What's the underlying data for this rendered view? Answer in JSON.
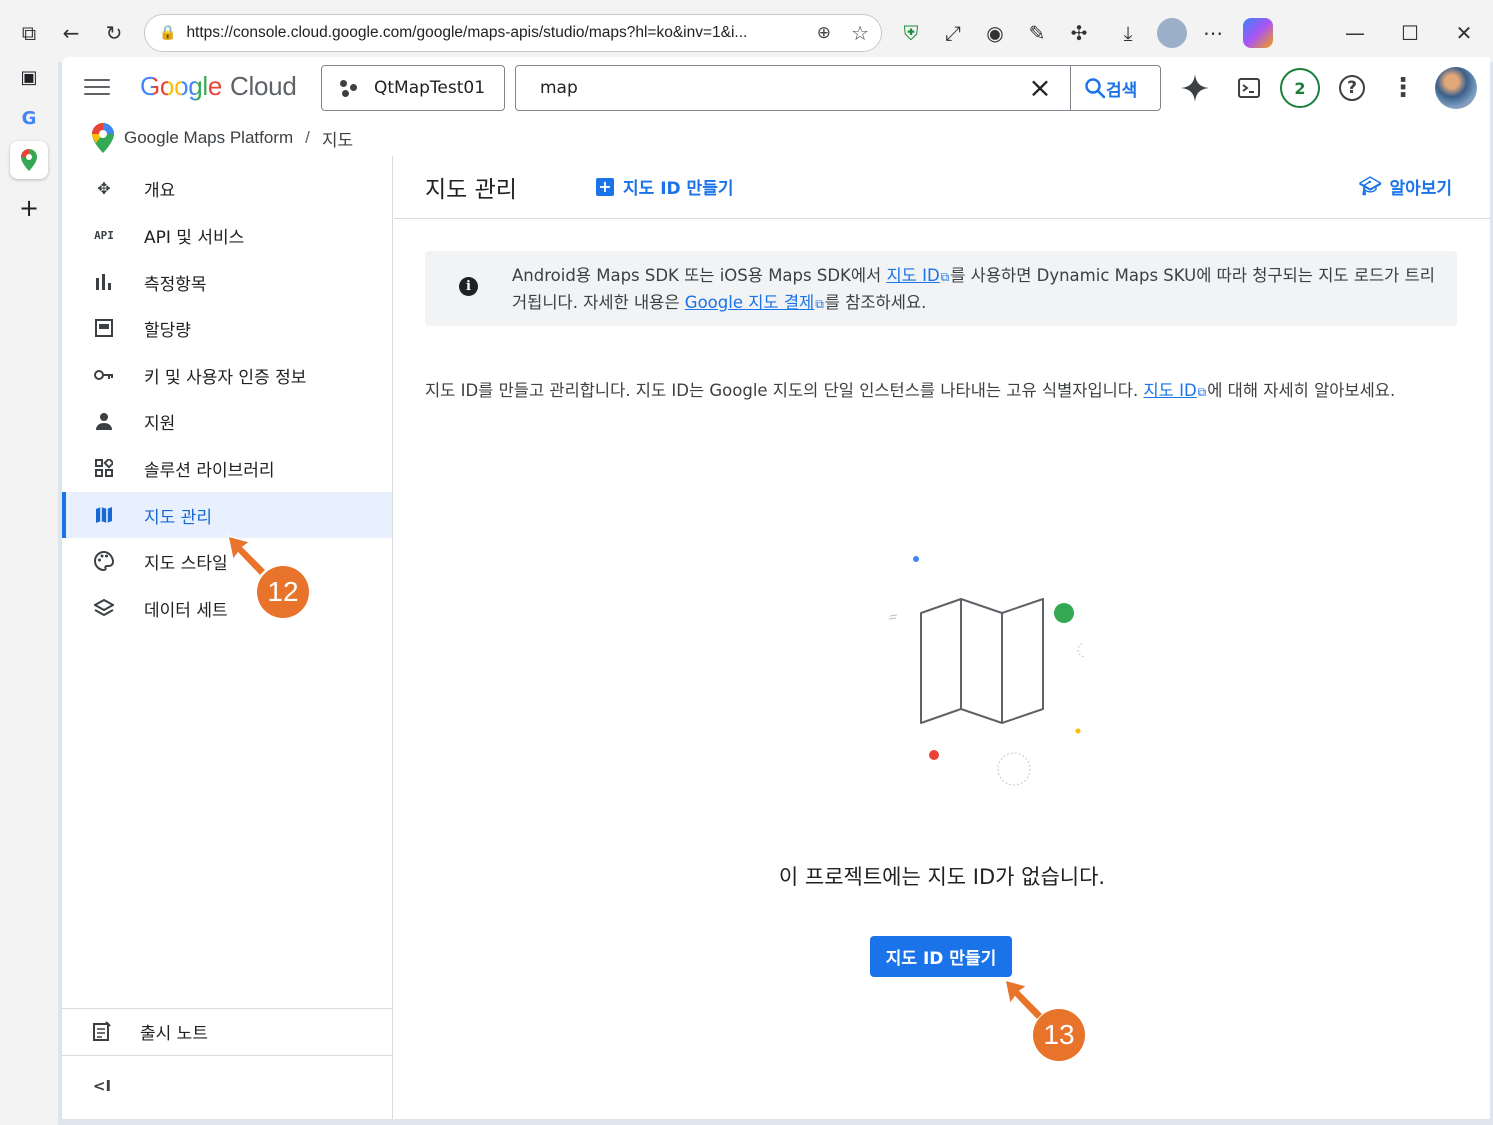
{
  "browser": {
    "url": "https://console.cloud.google.com/google/maps-apis/studio/maps?hl=ko&inv=1&i...",
    "window_controls": {
      "minimize": "—",
      "maximize": "☐",
      "close": "✕"
    }
  },
  "header": {
    "logo_google": "Google",
    "logo_cloud": "Cloud",
    "project_name": "QtMapTest01",
    "search_query": "map",
    "search_button": "검색",
    "notifications_count": "2",
    "help_label": "?"
  },
  "breadcrumb": {
    "root": "Google Maps Platform",
    "separator": "/",
    "current": "지도"
  },
  "sidebar": {
    "items": [
      {
        "label": "개요",
        "icon": "overview-icon"
      },
      {
        "label": "API 및 서비스",
        "icon": "api-icon"
      },
      {
        "label": "측정항목",
        "icon": "metrics-icon"
      },
      {
        "label": "할당량",
        "icon": "quota-icon"
      },
      {
        "label": "키 및 사용자 인증 정보",
        "icon": "key-icon"
      },
      {
        "label": "지원",
        "icon": "support-icon"
      },
      {
        "label": "솔루션 라이브러리",
        "icon": "solutions-icon"
      },
      {
        "label": "지도 관리",
        "icon": "map-icon",
        "active": true
      },
      {
        "label": "지도 스타일",
        "icon": "palette-icon"
      },
      {
        "label": "데이터 세트",
        "icon": "datasets-icon"
      }
    ],
    "release_notes": "출시 노트",
    "api_badge": "API",
    "collapse_glyph": "<I"
  },
  "main": {
    "title": "지도 관리",
    "create_link": "지도 ID 만들기",
    "learn_link": "알아보기",
    "banner": {
      "part1": "Android용 Maps SDK 또는 iOS용 Maps SDK에서 ",
      "link1": "지도 ID",
      "part2": "를 사용하면 Dynamic Maps SKU에 따라 청구되는 지도 로드가 트리거됩니다. 자세한 내용은 ",
      "link2": "Google 지도 결제",
      "part3": "를 참조하세요."
    },
    "description": {
      "part1": "지도 ID를 만들고 관리합니다. 지도 ID는 Google 지도의 단일 인스턴스를 나타내는 고유 식별자입니다. ",
      "link": "지도 ID",
      "part2": "에 대해 자세히 알아보세요."
    },
    "empty_message": "이 프로젝트에는 지도 ID가 없습니다.",
    "create_button": "지도 ID 만들기"
  },
  "annotations": {
    "callout_1": "12",
    "callout_2": "13",
    "color": "#e8732a"
  },
  "colors": {
    "accent": "#1a73e8",
    "active_bg": "#e8f0fe"
  }
}
